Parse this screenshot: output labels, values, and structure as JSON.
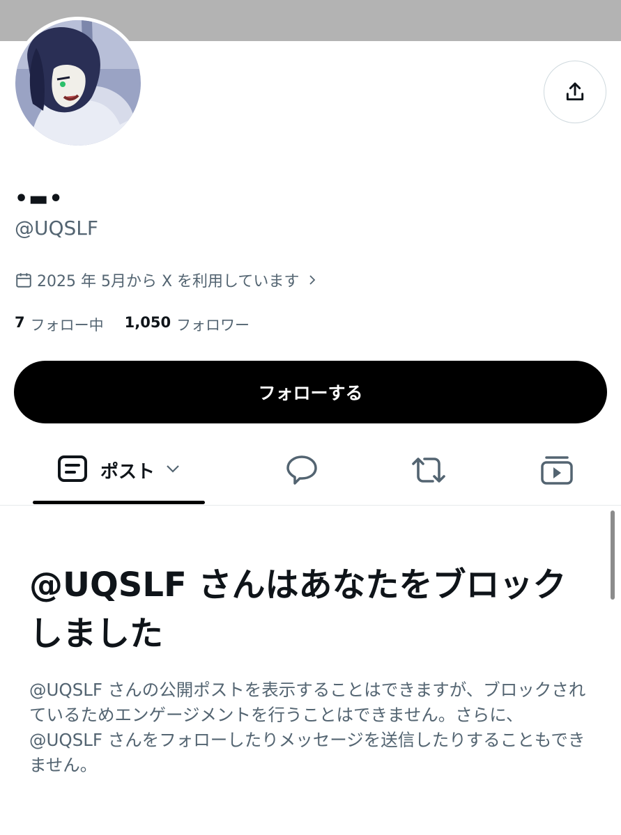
{
  "profile": {
    "display_name": "•▬•",
    "handle": "@UQSLF",
    "joined": "2025 年 5月から X を利用しています",
    "following_count": "7",
    "following_label": "フォロー中",
    "followers_count": "1,050",
    "followers_label": "フォロワー"
  },
  "actions": {
    "follow_label": "フォローする",
    "share_icon": "share-icon"
  },
  "tabs": [
    {
      "label": "ポスト",
      "icon": "posts-icon",
      "selected": true
    },
    {
      "label": "",
      "icon": "reply-bubble-icon"
    },
    {
      "label": "",
      "icon": "repost-icon"
    },
    {
      "label": "",
      "icon": "media-icon"
    }
  ],
  "blocked": {
    "title": "@UQSLF さんはあなたをブロックしました",
    "message": "@UQSLF さんの公開ポストを表示することはできますが、ブロックされているためエンゲージメントを行うことはできません。さらに、@UQSLF さんをフォローしたりメッセージを送信したりすることもできません。"
  },
  "colors": {
    "banner": "#b3b3b3",
    "primary_text": "#0f1419",
    "secondary_text": "#536471",
    "button_bg": "#000000"
  }
}
